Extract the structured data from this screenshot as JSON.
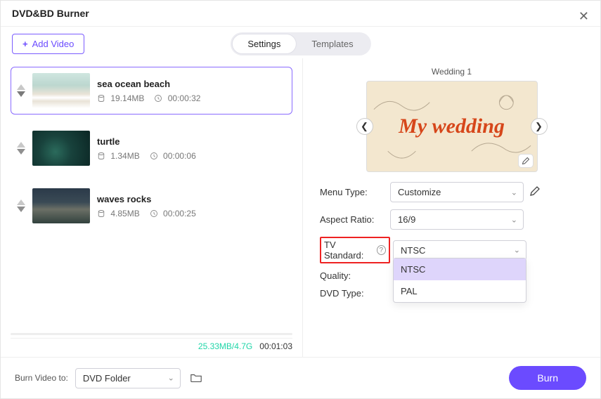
{
  "window": {
    "title": "DVD&BD Burner"
  },
  "toolbar": {
    "add_video": "Add Video"
  },
  "tabs": {
    "settings": "Settings",
    "templates": "Templates"
  },
  "items": [
    {
      "title": "sea ocean beach",
      "size": "19.14MB",
      "duration": "00:00:32",
      "selected": true,
      "thumb": "beach"
    },
    {
      "title": "turtle",
      "size": "1.34MB",
      "duration": "00:00:06",
      "selected": false,
      "thumb": "turtle"
    },
    {
      "title": "waves rocks",
      "size": "4.85MB",
      "duration": "00:00:25",
      "selected": false,
      "thumb": "waves"
    }
  ],
  "left_footer": {
    "total": "25.33MB/4.7G",
    "runtime": "00:01:03"
  },
  "preview": {
    "name": "Wedding 1",
    "caption": "My wedding"
  },
  "form": {
    "menu_type": {
      "label": "Menu Type:",
      "value": "Customize"
    },
    "aspect_ratio": {
      "label": "Aspect Ratio:",
      "value": "16/9"
    },
    "tv_standard": {
      "label": "TV Standard:",
      "value": "NTSC",
      "options": [
        "NTSC",
        "PAL"
      ]
    },
    "quality": {
      "label": "Quality:"
    },
    "dvd_type": {
      "label": "DVD Type:"
    }
  },
  "footer": {
    "label": "Burn Video to:",
    "target": "DVD Folder",
    "burn": "Burn"
  }
}
